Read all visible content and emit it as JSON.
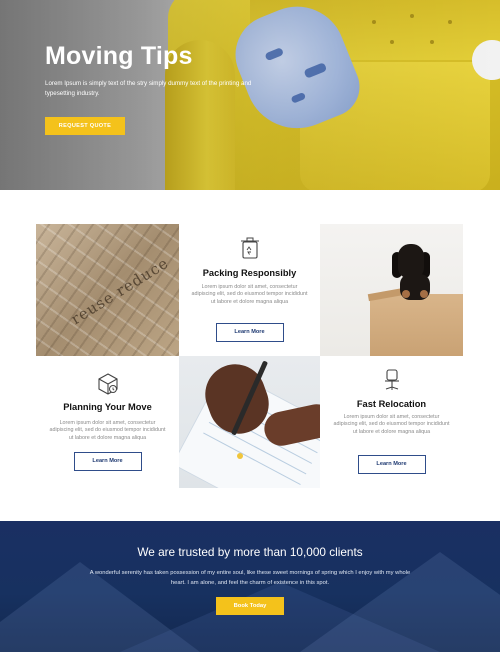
{
  "hero": {
    "title": "Moving Tips",
    "lead": "Lorem Ipsum is simply text of the stry simply dummy text of the printing and typesetting industry.",
    "button_label": "REQUEST QUOTE"
  },
  "photos": {
    "cardboard_text": "reuse reduce"
  },
  "cards": [
    {
      "title": "Packing Responsibly",
      "body": "Lorem ipsum dolor sit amet, consectetur adipiscing elit, sed do eiusmod tempor incididunt ut labore et dolore magna aliqua",
      "button_label": "Learn More",
      "icon": "recycle-bin-icon"
    },
    {
      "title": "Planning Your Move",
      "body": "Lorem ipsum dolor sit amet, consectetur adipiscing elit, sed do eiusmod tempor incididunt ut labore et dolore magna aliqua",
      "button_label": "Learn More",
      "icon": "package-box-icon"
    },
    {
      "title": "Fast Relocation",
      "body": "Lorem ipsum dolor sit amet, consectetur adipiscing elit, sed do eiusmod tempor incididunt ut labore et dolore magna aliqua",
      "button_label": "Learn More",
      "icon": "office-chair-icon"
    }
  ],
  "trust": {
    "title": "We are trusted by more than 10,000 clients",
    "body": "A wonderful serenity has taken possession of my entire soul, like these sweet mornings of spring which I enjoy with my whole heart. I am alone, and feel the charm of existence in this spot.",
    "button_label": "Book Today"
  },
  "colors": {
    "accent": "#f4c21b",
    "navy": "#1a2f63",
    "outline": "#2f4d8a"
  }
}
